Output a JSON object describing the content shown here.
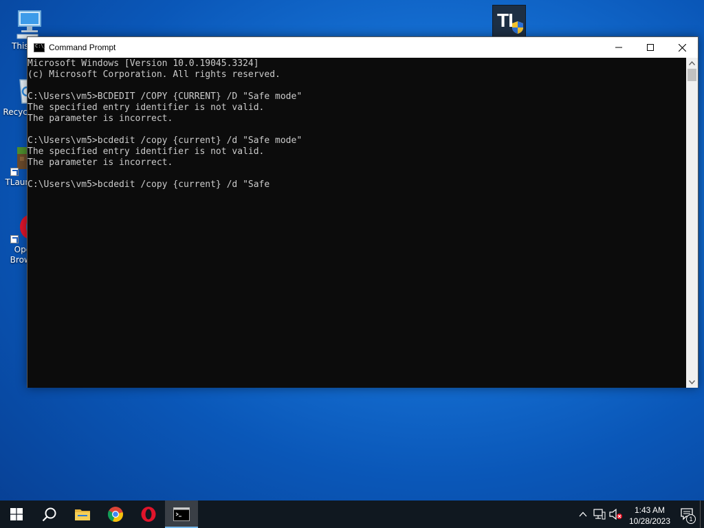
{
  "desktop": {
    "icons": [
      {
        "label": "This PC"
      },
      {
        "label": "Recycle Bin"
      },
      {
        "label": "TLauncher"
      },
      {
        "label": "Opera Browser"
      }
    ],
    "tl_icon_text": "TL"
  },
  "window": {
    "title": "Command Prompt",
    "app_icon_text": "C:\\_",
    "console_lines": [
      "Microsoft Windows [Version 10.0.19045.3324]",
      "(c) Microsoft Corporation. All rights reserved.",
      "",
      "C:\\Users\\vm5>BCDEDIT /COPY {CURRENT} /D \"Safe mode\"",
      "The specified entry identifier is not valid.",
      "The parameter is incorrect.",
      "",
      "C:\\Users\\vm5>bcdedit /copy {current} /d \"Safe mode\"",
      "The specified entry identifier is not valid.",
      "The parameter is incorrect.",
      "",
      "C:\\Users\\vm5>bcdedit /copy {current} /d \"Safe"
    ]
  },
  "taskbar": {
    "clock_time": "1:43 AM",
    "clock_date": "10/28/2023",
    "notification_count": "1"
  },
  "colors": {
    "accent": "#76b9ed",
    "console_bg": "#0c0c0c",
    "console_fg": "#cccccc",
    "taskbar_bg": "#101820"
  }
}
